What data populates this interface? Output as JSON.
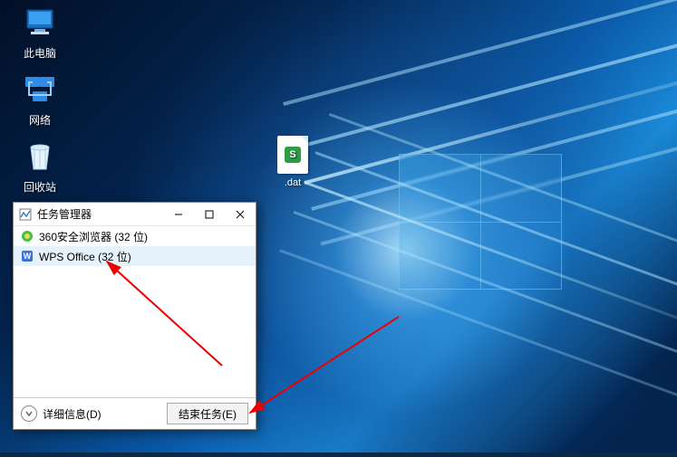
{
  "desktop": {
    "icons": [
      {
        "name": "此电脑"
      },
      {
        "name": "网络"
      },
      {
        "name": "回收站"
      }
    ],
    "file": {
      "label": ".dat"
    }
  },
  "taskmgr": {
    "title": "任务管理器",
    "processes": [
      {
        "name": "360安全浏览器 (32 位)"
      },
      {
        "name": "WPS Office (32 位)"
      }
    ],
    "details_label": "详细信息(D)",
    "end_task_label": "结束任务(E)"
  }
}
